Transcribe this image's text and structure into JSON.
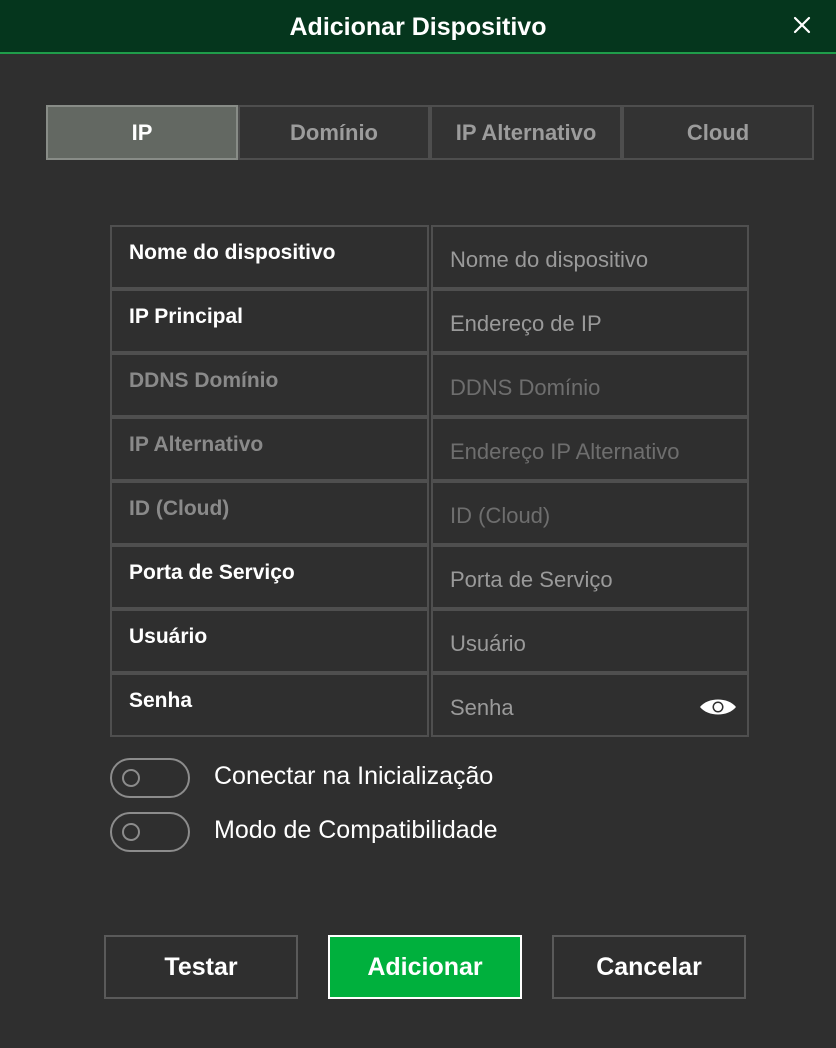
{
  "dialog": {
    "title": "Adicionar Dispositivo"
  },
  "tabs": [
    {
      "label": "IP",
      "active": true
    },
    {
      "label": "Domínio",
      "active": false
    },
    {
      "label": "IP Alternativo",
      "active": false
    },
    {
      "label": "Cloud",
      "active": false
    }
  ],
  "fields": {
    "device_name": {
      "label": "Nome do dispositivo",
      "placeholder": "Nome do dispositivo",
      "value": ""
    },
    "main_ip": {
      "label": "IP Principal",
      "placeholder": "Endereço de IP",
      "value": ""
    },
    "ddns_domain": {
      "label": "DDNS Domínio",
      "placeholder": "DDNS Domínio",
      "value": "",
      "disabled": true
    },
    "alt_ip": {
      "label": "IP Alternativo",
      "placeholder": "Endereço IP Alternativo",
      "value": "",
      "disabled": true
    },
    "cloud_id": {
      "label": "ID (Cloud)",
      "placeholder": "ID (Cloud)",
      "value": "",
      "disabled": true
    },
    "service_port": {
      "label": "Porta de Serviço",
      "placeholder": "Porta de Serviço",
      "value": ""
    },
    "username": {
      "label": "Usuário",
      "placeholder": "Usuário",
      "value": ""
    },
    "password": {
      "label": "Senha",
      "placeholder": "Senha",
      "value": "",
      "icon": "eye-icon"
    }
  },
  "toggles": {
    "connect_on_startup": {
      "label": "Conectar na Inicialização",
      "on": false
    },
    "compatibility_mode": {
      "label": "Modo de Compatibilidade",
      "on": false
    }
  },
  "buttons": {
    "test": "Testar",
    "add": "Adicionar",
    "cancel": "Cancelar"
  },
  "colors": {
    "titlebar": "#05361d",
    "accent": "#00b03d",
    "background": "#2f2f2f",
    "active_tab": "#636862"
  }
}
